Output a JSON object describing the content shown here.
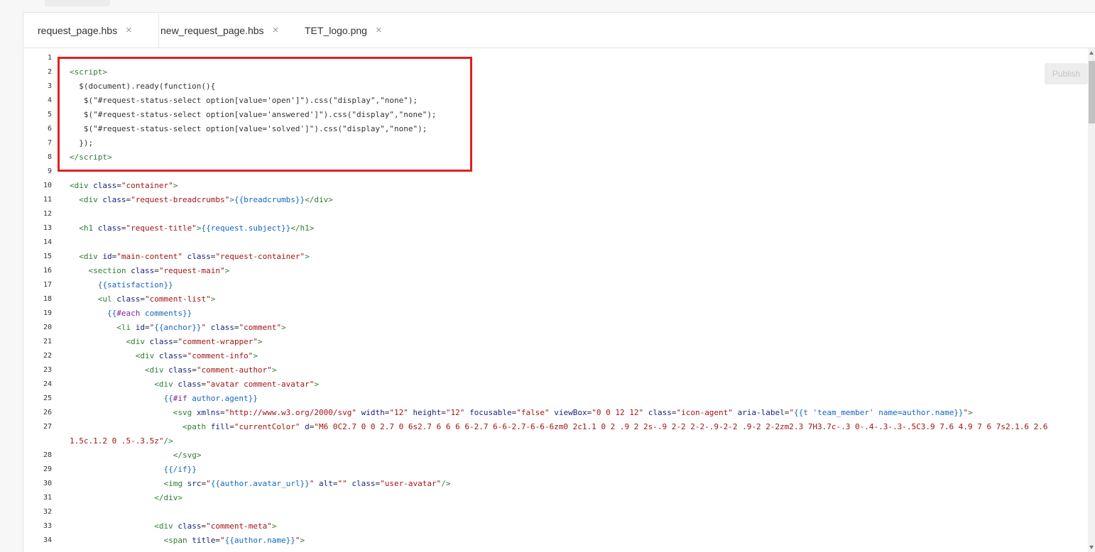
{
  "tabs": [
    {
      "label": "request_page.hbs",
      "close": "×"
    },
    {
      "label": "new_request_page.hbs",
      "close": "×"
    },
    {
      "label": "TET_logo.png",
      "close": "×"
    }
  ],
  "publish_label": "Publish",
  "code_lines": [
    {
      "n": "1",
      "html": ""
    },
    {
      "n": "2",
      "html": "<span class=\"t\">&lt;script&gt;</span>"
    },
    {
      "n": "3",
      "html": "  $(document).ready(function(){"
    },
    {
      "n": "4",
      "html": "   $(\"#request-status-select option[value='open']\").css(\"display\",\"none\");"
    },
    {
      "n": "5",
      "html": "   $(\"#request-status-select option[value='answered']\").css(\"display\",\"none\");"
    },
    {
      "n": "6",
      "html": "   $(\"#request-status-select option[value='solved']\").css(\"display\",\"none\");"
    },
    {
      "n": "7",
      "html": "  });"
    },
    {
      "n": "8",
      "html": "<span class=\"t\">&lt;/script&gt;</span>"
    },
    {
      "n": "9",
      "html": ""
    },
    {
      "n": "10",
      "html": "<span class=\"t\">&lt;div</span> <span class=\"an\">class</span>=<span class=\"av\">\"container\"</span><span class=\"t\">&gt;</span>"
    },
    {
      "n": "11",
      "html": "  <span class=\"t\">&lt;div</span> <span class=\"an\">class</span>=<span class=\"av\">\"request-breadcrumbs\"</span><span class=\"t\">&gt;</span><span class=\"hb\">{{breadcrumbs}}</span><span class=\"t\">&lt;/div&gt;</span>"
    },
    {
      "n": "12",
      "html": ""
    },
    {
      "n": "13",
      "html": "  <span class=\"t\">&lt;h1</span> <span class=\"an\">class</span>=<span class=\"av\">\"request-title\"</span><span class=\"t\">&gt;</span><span class=\"hb\">{{request.subject}}</span><span class=\"t\">&lt;/h1&gt;</span>"
    },
    {
      "n": "14",
      "html": ""
    },
    {
      "n": "15",
      "html": "  <span class=\"t\">&lt;div</span> <span class=\"an\">id</span>=<span class=\"av\">\"main-content\"</span> <span class=\"an\">class</span>=<span class=\"av\">\"request-container\"</span><span class=\"t\">&gt;</span>"
    },
    {
      "n": "16",
      "html": "    <span class=\"t\">&lt;section</span> <span class=\"an\">class</span>=<span class=\"av\">\"request-main\"</span><span class=\"t\">&gt;</span>"
    },
    {
      "n": "17",
      "html": "      <span class=\"hb\">{{satisfaction}}</span>"
    },
    {
      "n": "18",
      "html": "      <span class=\"t\">&lt;ul</span> <span class=\"an\">class</span>=<span class=\"av\">\"comment-list\"</span><span class=\"t\">&gt;</span>"
    },
    {
      "n": "19",
      "html": "        <span class=\"hb\">{{<span class=\"kw\">#each</span> comments}}</span>"
    },
    {
      "n": "20",
      "html": "          <span class=\"t\">&lt;li</span> <span class=\"an\">id</span>=<span class=\"av\">\"<span class=\"hb\">{{anchor}}</span>\"</span> <span class=\"an\">class</span>=<span class=\"av\">\"comment\"</span><span class=\"t\">&gt;</span>"
    },
    {
      "n": "21",
      "html": "            <span class=\"t\">&lt;div</span> <span class=\"an\">class</span>=<span class=\"av\">\"comment-wrapper\"</span><span class=\"t\">&gt;</span>"
    },
    {
      "n": "22",
      "html": "              <span class=\"t\">&lt;div</span> <span class=\"an\">class</span>=<span class=\"av\">\"comment-info\"</span><span class=\"t\">&gt;</span>"
    },
    {
      "n": "23",
      "html": "                <span class=\"t\">&lt;div</span> <span class=\"an\">class</span>=<span class=\"av\">\"comment-author\"</span><span class=\"t\">&gt;</span>"
    },
    {
      "n": "24",
      "html": "                  <span class=\"t\">&lt;div</span> <span class=\"an\">class</span>=<span class=\"av\">\"avatar comment-avatar\"</span><span class=\"t\">&gt;</span>"
    },
    {
      "n": "25",
      "html": "                    <span class=\"hb\">{{<span class=\"kw\">#if</span> author.agent}}</span>"
    },
    {
      "n": "26",
      "html": "                      <span class=\"t\">&lt;svg</span> <span class=\"an\">xmlns</span>=<span class=\"av\">\"http://www.w3.org/2000/svg\"</span> <span class=\"an\">width</span>=<span class=\"av\">\"12\"</span> <span class=\"an\">height</span>=<span class=\"av\">\"12\"</span> <span class=\"an\">focusable</span>=<span class=\"av\">\"false\"</span> <span class=\"an\">viewBox</span>=<span class=\"av\">\"0 0 12 12\"</span> <span class=\"an\">class</span>=<span class=\"av\">\"icon-agent\"</span> <span class=\"an\">aria-label</span>=<span class=\"av\">\"<span class=\"hb\">{{t 'team_member' name=author.name}}</span>\"</span><span class=\"t\">&gt;</span>"
    },
    {
      "n": "27",
      "html": "                        <span class=\"t\">&lt;path</span> <span class=\"an\">fill</span>=<span class=\"av\">\"currentColor\"</span> <span class=\"an\">d</span>=<span class=\"av\">\"M6 0C2.7 0 0 2.7 0 6s2.7 6 6 6 6-2.7 6-6-2.7-6-6-6zm0 2c1.1 0 2 .9 2 2s-.9 2-2 2-2-.9-2-2 .9-2 2-2zm2.3 7H3.7c-.3 0-.4-.3-.3-.5C3.9 7.6 4.9 7 6 7s2.1.6 2.6</span>"
    },
    {
      "n": "",
      "html": "<span class=\"av\">1.5c.1.2 0 .5-.3.5z\"</span><span class=\"t\">/&gt;</span>"
    },
    {
      "n": "28",
      "html": "                      <span class=\"t\">&lt;/svg&gt;</span>"
    },
    {
      "n": "29",
      "html": "                    <span class=\"hb\">{{/if}}</span>"
    },
    {
      "n": "30",
      "html": "                    <span class=\"t\">&lt;img</span> <span class=\"an\">src</span>=<span class=\"av\">\"<span class=\"hb\">{{author.avatar_url}}</span>\"</span> <span class=\"an\">alt</span>=<span class=\"av\">\"\"</span> <span class=\"an\">class</span>=<span class=\"av\">\"user-avatar\"</span><span class=\"t\">/&gt;</span>"
    },
    {
      "n": "31",
      "html": "                  <span class=\"t\">&lt;/div&gt;</span>"
    },
    {
      "n": "32",
      "html": ""
    },
    {
      "n": "33",
      "html": "                  <span class=\"t\">&lt;div</span> <span class=\"an\">class</span>=<span class=\"av\">\"comment-meta\"</span><span class=\"t\">&gt;</span>"
    },
    {
      "n": "34",
      "html": "                    <span class=\"t\">&lt;span</span> <span class=\"an\">title</span>=<span class=\"av\">\"<span class=\"hb\">{{author.name}}</span>\"</span><span class=\"t\">&gt;</span>"
    }
  ]
}
